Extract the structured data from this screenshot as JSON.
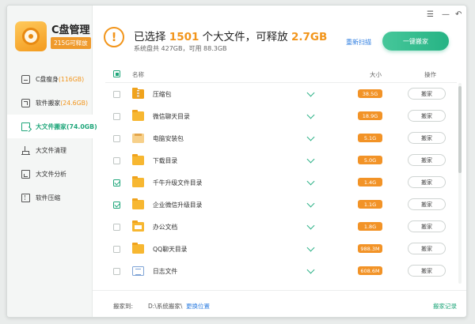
{
  "app": {
    "title": "C盘管理",
    "badge": "215G可释放"
  },
  "window_controls": {
    "menu": "☰",
    "minimize": "—",
    "back": "↶"
  },
  "sidebar": {
    "items": [
      {
        "label": "C盘瘦身",
        "sub": "(116GB)",
        "icon": "disk-slim-icon",
        "active": false
      },
      {
        "label": "软件搬家",
        "sub": "(24.6GB)",
        "icon": "software-move-icon",
        "active": false
      },
      {
        "label": "大文件搬家",
        "sub": "(74.0GB)",
        "icon": "large-file-move-icon",
        "active": true
      },
      {
        "label": "大文件清理",
        "sub": "",
        "icon": "cleanup-icon",
        "active": false
      },
      {
        "label": "大文件分析",
        "sub": "",
        "icon": "analysis-icon",
        "active": false
      },
      {
        "label": "软件压缩",
        "sub": "",
        "icon": "compress-icon",
        "active": false
      }
    ]
  },
  "header": {
    "headline_pre": "已选择 ",
    "count": "1501",
    "headline_mid": " 个大文件，可释放 ",
    "size": "2.7GB",
    "subline": "系统盘共 427GB，可用 88.3GB",
    "rescan": "重新扫描",
    "primary": "一键搬家"
  },
  "table": {
    "columns": {
      "name": "名称",
      "size": "大小",
      "action": "操作"
    },
    "rows": [
      {
        "name": "压缩包",
        "size": "38.5G",
        "checked": false,
        "icon": "zip-folder-icon"
      },
      {
        "name": "微信聊天目录",
        "size": "18.9G",
        "checked": false,
        "icon": "folder-icon"
      },
      {
        "name": "电脑安装包",
        "size": "5.1G",
        "checked": false,
        "icon": "package-folder-icon"
      },
      {
        "name": "下载目录",
        "size": "5.0G",
        "checked": false,
        "icon": "folder-icon"
      },
      {
        "name": "千牛升级文件目录",
        "size": "1.4G",
        "checked": true,
        "icon": "folder-icon"
      },
      {
        "name": "企业微信升级目录",
        "size": "1.1G",
        "checked": true,
        "icon": "folder-icon"
      },
      {
        "name": "办公文档",
        "size": "1.8G",
        "checked": false,
        "icon": "document-folder-icon"
      },
      {
        "name": "QQ聊天目录",
        "size": "988.3M",
        "checked": false,
        "icon": "folder-icon"
      },
      {
        "name": "日志文件",
        "size": "608.6M",
        "checked": false,
        "icon": "log-file-icon"
      }
    ],
    "move_label": "搬家"
  },
  "footer": {
    "label": "搬家到:",
    "path": "D:\\系统搬家\\",
    "change": "更换位置",
    "history": "搬家记录"
  },
  "colors": {
    "accent": "#1fa67a",
    "orange": "#f2951b",
    "link": "#2d7de0"
  }
}
